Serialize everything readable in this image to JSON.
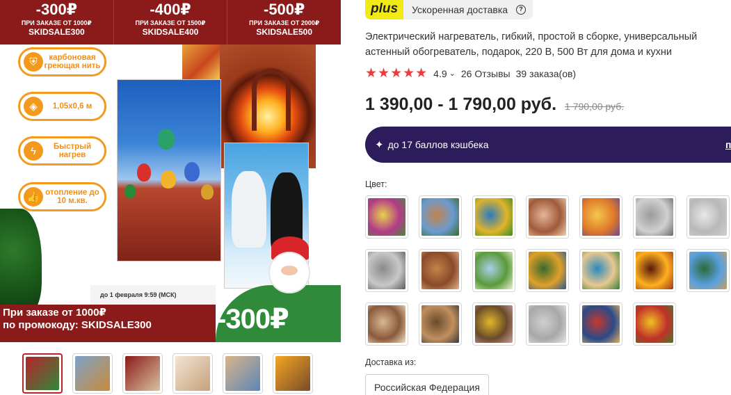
{
  "promo_bar": [
    {
      "amount": "-300₽",
      "condition": "ПРИ ЗАКАЗЕ ОТ 1000₽",
      "code": "SKIDSALE300"
    },
    {
      "amount": "-400₽",
      "condition": "ПРИ ЗАКАЗЕ ОТ 1500₽",
      "code": "SKIDSALE400"
    },
    {
      "amount": "-500₽",
      "condition": "ПРИ ЗАКАЗЕ ОТ 2000₽",
      "code": "SKIDSALE500"
    }
  ],
  "features": [
    {
      "icon": "shield-icon",
      "text": "карбоновая греющая нить"
    },
    {
      "icon": "layers-icon",
      "text": "1,05х0,6 м"
    },
    {
      "icon": "lightning-icon",
      "text": "Быстрый нагрев"
    },
    {
      "icon": "thumbs-up-icon",
      "text": "отопление до 10 м.кв."
    }
  ],
  "deadline": "до 1 февраля 9:59 (МСК)",
  "bottom_promo": {
    "line1": "При заказе от 1000₽",
    "line2": "по промокоду: SKIDSALE300",
    "discount": "-300₽"
  },
  "thumbnails": [
    {
      "colors": [
        "#b8232a",
        "#2f8a3a"
      ]
    },
    {
      "colors": [
        "#7da3c9",
        "#c98a3a"
      ]
    },
    {
      "colors": [
        "#8b1a1a",
        "#d8c2a0"
      ]
    },
    {
      "colors": [
        "#f2e4d4",
        "#c7a07a"
      ]
    },
    {
      "colors": [
        "#d9b48a",
        "#5d86b8"
      ]
    },
    {
      "colors": [
        "#f5a623",
        "#7a4a2a"
      ]
    }
  ],
  "plus": {
    "logo": "plus",
    "text": "Ускоренная доставка",
    "help": "?"
  },
  "product": {
    "title_line1": "Электрический нагреватель, гибкий, простой в сборке, универсальный",
    "title_line2": "астенный обогреватель, подарок, 220 В, 500 Вт для дома и кухни",
    "stars": "★★★★★",
    "rating": "4.9",
    "reviews": "26 Отзывы",
    "orders": "39 заказа(ов)",
    "price": "1 390,00 - 1 790,00 руб.",
    "old_price": "1 790,00 руб."
  },
  "cashback": {
    "text": "до 17 баллов кэшбека",
    "link": "п"
  },
  "color_label": "Цвет:",
  "swatches": [
    {
      "colors": [
        "#e6d24a",
        "#b23a8a",
        "#4a8a3a"
      ]
    },
    {
      "colors": [
        "#c2844a",
        "#6a9ad0",
        "#3a6a2a"
      ]
    },
    {
      "colors": [
        "#2a7ac0",
        "#e0b42a",
        "#3a8a2a"
      ]
    },
    {
      "colors": [
        "#e6b49a",
        "#a05a3a",
        "#f0d0b0"
      ]
    },
    {
      "colors": [
        "#f2c84a",
        "#e07a2a",
        "#6a4a8a"
      ]
    },
    {
      "colors": [
        "#9a9a9a",
        "#d0d0d0",
        "#6a6a6a"
      ]
    },
    {
      "colors": [
        "#e8e8e8",
        "#b8b8b8",
        "#d0d0d0"
      ]
    },
    {
      "colors": [
        "#8a8a8a",
        "#c8c8c8",
        "#5a5a5a"
      ]
    },
    {
      "colors": [
        "#c2844a",
        "#8a4a2a",
        "#e0b48a"
      ]
    },
    {
      "colors": [
        "#a8d0e8",
        "#5a9a3a",
        "#e8f0d0"
      ]
    },
    {
      "colors": [
        "#3a6a2a",
        "#e0a02a",
        "#2a5a8a"
      ]
    },
    {
      "colors": [
        "#2a8ac0",
        "#e8c890",
        "#3a7a3a"
      ]
    },
    {
      "colors": [
        "#5a1a0a",
        "#ffb020",
        "#9a3a1c"
      ]
    },
    {
      "colors": [
        "#2a6a3a",
        "#5aa0e0",
        "#c8a060"
      ]
    },
    {
      "colors": [
        "#d8b890",
        "#8a5a3a",
        "#f0e0c8"
      ]
    },
    {
      "colors": [
        "#6a4a2a",
        "#c09060",
        "#3a3a3a"
      ]
    },
    {
      "colors": [
        "#e0b82a",
        "#6a4a2a",
        "#c8a0a0"
      ]
    },
    {
      "colors": [
        "#cfcfcf",
        "#a8a8a8",
        "#e6e6e6"
      ]
    },
    {
      "colors": [
        "#c8382a",
        "#2a4a8a",
        "#e0b060"
      ]
    },
    {
      "colors": [
        "#f0c020",
        "#c0302a",
        "#4a7a2a"
      ]
    }
  ],
  "shipping": {
    "label": "Доставка из:",
    "value": "Российская Федерация"
  }
}
